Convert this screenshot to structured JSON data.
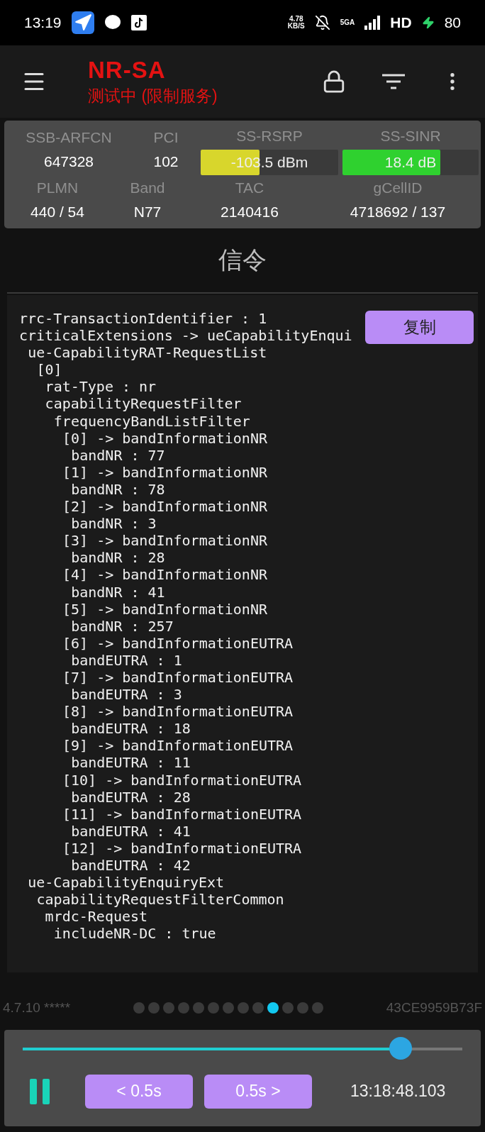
{
  "status_bar": {
    "time": "13:19",
    "speed_value": "4.78",
    "speed_unit": "KB/S",
    "network": "5GA",
    "hd": "HD",
    "battery": "80"
  },
  "app_bar": {
    "title": "NR-SA",
    "subtitle": "测试中 (限制服务)"
  },
  "cell_info": {
    "top": [
      {
        "kind": "text",
        "label": "SSB-ARFCN",
        "value": "647328"
      },
      {
        "kind": "text",
        "label": "PCI",
        "value": "102"
      },
      {
        "kind": "meter",
        "label": "SS-RSRP",
        "value": "-103.5 dBm",
        "level": 0.43,
        "color": "#d8d62c"
      },
      {
        "kind": "meter",
        "label": "SS-SINR",
        "value": "18.4 dB",
        "level": 0.72,
        "color": "#2fd12f"
      }
    ],
    "bottom": [
      {
        "kind": "text",
        "label": "PLMN",
        "value": "440 / 54"
      },
      {
        "kind": "text",
        "label": "Band",
        "value": "N77"
      },
      {
        "kind": "text",
        "label": "TAC",
        "value": "2140416"
      },
      {
        "kind": "text",
        "label": "gCellID",
        "value": "4718692 / 137"
      }
    ]
  },
  "section_title": "信令",
  "decode": {
    "copy_button": "复制",
    "tree": [
      {
        "text": "rrc-TransactionIdentifier : 1"
      },
      {
        "text": "criticalExtensions -> ueCapabilityEnqui",
        "children": [
          {
            "text": "ue-CapabilityRAT-RequestList",
            "children": [
              {
                "text": "[0]",
                "children": [
                  {
                    "text": "rat-Type : nr"
                  },
                  {
                    "text": "capabilityRequestFilter",
                    "children": [
                      {
                        "text": "frequencyBandListFilter",
                        "children": [
                          {
                            "text": "[0] -> bandInformationNR",
                            "children": [
                              {
                                "text": "bandNR : 77"
                              }
                            ]
                          },
                          {
                            "text": "[1] -> bandInformationNR",
                            "children": [
                              {
                                "text": "bandNR : 78"
                              }
                            ]
                          },
                          {
                            "text": "[2] -> bandInformationNR",
                            "children": [
                              {
                                "text": "bandNR : 3"
                              }
                            ]
                          },
                          {
                            "text": "[3] -> bandInformationNR",
                            "children": [
                              {
                                "text": "bandNR : 28"
                              }
                            ]
                          },
                          {
                            "text": "[4] -> bandInformationNR",
                            "children": [
                              {
                                "text": "bandNR : 41"
                              }
                            ]
                          },
                          {
                            "text": "[5] -> bandInformationNR",
                            "children": [
                              {
                                "text": "bandNR : 257"
                              }
                            ]
                          },
                          {
                            "text": "[6] -> bandInformationEUTRA",
                            "children": [
                              {
                                "text": "bandEUTRA : 1"
                              }
                            ]
                          },
                          {
                            "text": "[7] -> bandInformationEUTRA",
                            "children": [
                              {
                                "text": "bandEUTRA : 3"
                              }
                            ]
                          },
                          {
                            "text": "[8] -> bandInformationEUTRA",
                            "children": [
                              {
                                "text": "bandEUTRA : 18"
                              }
                            ]
                          },
                          {
                            "text": "[9] -> bandInformationEUTRA",
                            "children": [
                              {
                                "text": "bandEUTRA : 11"
                              }
                            ]
                          },
                          {
                            "text": "[10] -> bandInformationEUTRA",
                            "children": [
                              {
                                "text": "bandEUTRA : 28"
                              }
                            ]
                          },
                          {
                            "text": "[11] -> bandInformationEUTRA",
                            "children": [
                              {
                                "text": "bandEUTRA : 41"
                              }
                            ]
                          },
                          {
                            "text": "[12] -> bandInformationEUTRA",
                            "children": [
                              {
                                "text": "bandEUTRA : 42"
                              }
                            ]
                          }
                        ]
                      }
                    ]
                  }
                ]
              }
            ]
          },
          {
            "text": "ue-CapabilityEnquiryExt",
            "children": [
              {
                "text": "capabilityRequestFilterCommon",
                "children": [
                  {
                    "text": "mrdc-Request",
                    "children": [
                      {
                        "text": "includeNR-DC : true"
                      }
                    ]
                  }
                ]
              }
            ]
          }
        ]
      }
    ]
  },
  "footer": {
    "version": "4.7.10 *****",
    "device_id": "43CE9959B73F",
    "pages": [
      {
        "selected": false
      },
      {
        "selected": false
      },
      {
        "selected": false
      },
      {
        "selected": false
      },
      {
        "selected": false
      },
      {
        "selected": false
      },
      {
        "selected": false
      },
      {
        "selected": false
      },
      {
        "selected": false
      },
      {
        "selected": true
      },
      {
        "selected": false
      },
      {
        "selected": false
      },
      {
        "selected": false
      }
    ]
  },
  "player": {
    "level": 0.86,
    "playing": true,
    "back_button": "< 0.5s",
    "forward_button": "0.5s >",
    "time": "13:18:48.103"
  }
}
